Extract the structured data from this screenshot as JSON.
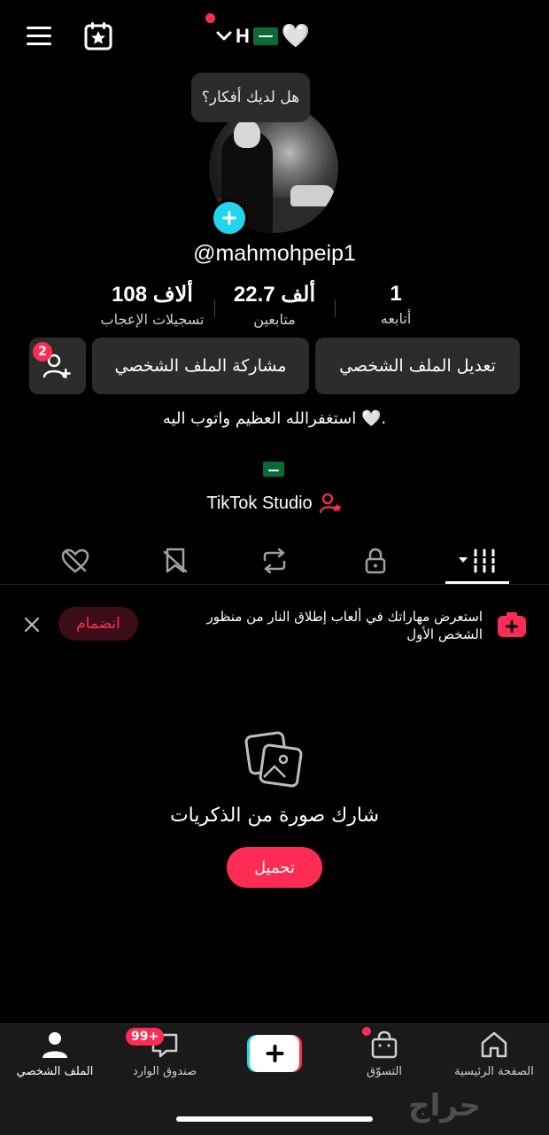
{
  "header": {
    "account_name": "H",
    "heart": "🤍",
    "tooltip": "هل لديك أفكار؟"
  },
  "profile": {
    "username": "@mahmohpeip1",
    "stats": [
      {
        "value": "108 ألاف",
        "label": "تسجيلات الإعجاب"
      },
      {
        "value": "22.7 ألف",
        "label": "متابعين"
      },
      {
        "value": "1",
        "label": "أتابعه"
      }
    ],
    "buttons": {
      "edit": "تعديل الملف الشخصي",
      "share": "مشاركة الملف الشخصي",
      "add_friends_badge": "2"
    },
    "bio": "استغفرالله العظيم واتوب اليه 🤍.",
    "studio": "TikTok Studio"
  },
  "promo": {
    "text": "استعرض مهاراتك في ألعاب إطلاق النار من منظور الشخص الأول",
    "join": "انضمام"
  },
  "empty_state": {
    "title": "شارك صورة من الذكريات",
    "upload": "تحميل"
  },
  "bottom_nav": {
    "home": "الصفحة الرئيسية",
    "shop": "التسوّق",
    "inbox": "صندوق الوارد",
    "inbox_badge": "99+",
    "profile": "الملف الشخصي"
  },
  "watermark": "حراج",
  "colors": {
    "accent": "#fe2c55",
    "story_add": "#20d5ec",
    "background": "#000000"
  }
}
